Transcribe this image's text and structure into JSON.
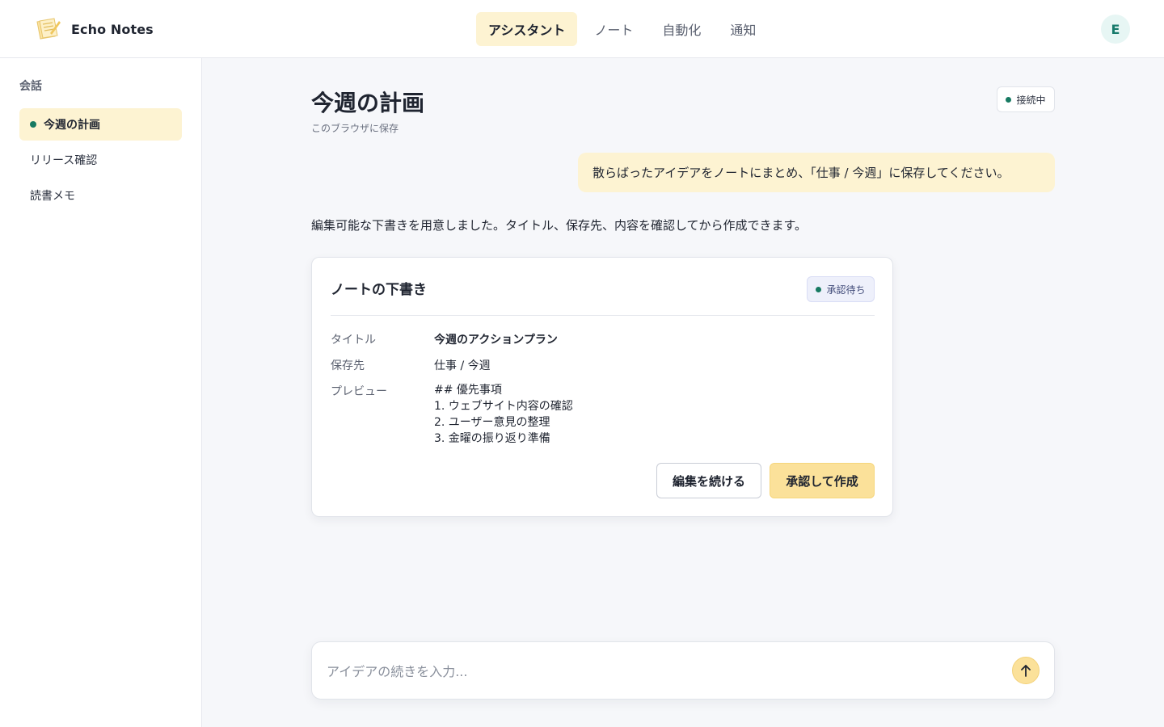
{
  "app": {
    "name": "Echo Notes"
  },
  "nav": {
    "tabs": [
      {
        "label": "アシスタント",
        "active": true
      },
      {
        "label": "ノート",
        "active": false
      },
      {
        "label": "自動化",
        "active": false
      },
      {
        "label": "通知",
        "active": false
      }
    ]
  },
  "user": {
    "avatar_initial": "E"
  },
  "sidebar": {
    "heading": "会話",
    "items": [
      {
        "label": "今週の計画",
        "active": true
      },
      {
        "label": "リリース確認",
        "active": false
      },
      {
        "label": "読書メモ",
        "active": false
      }
    ]
  },
  "conversation": {
    "title": "今週の計画",
    "subtitle": "このブラウザに保存",
    "status": "接続中",
    "user_message": "散らばったアイデアをノートにまとめ、「仕事 / 今週」に保存してください。",
    "assistant_message": "編集可能な下書きを用意しました。タイトル、保存先、内容を確認してから作成できます。"
  },
  "draft": {
    "heading": "ノートの下書き",
    "badge": "承認待ち",
    "fields": {
      "title_label": "タイトル",
      "title_value": "今週のアクションプラン",
      "location_label": "保存先",
      "location_value": "仕事 / 今週",
      "preview_label": "プレビュー",
      "preview_lines": [
        "## 優先事項",
        "1. ウェブサイト内容の確認",
        "2. ユーザー意見の整理",
        "3. 金曜の振り返り準備"
      ]
    },
    "buttons": {
      "continue_editing": "編集を続ける",
      "approve_create": "承認して作成"
    }
  },
  "composer": {
    "placeholder": "アイデアの続きを入力...",
    "value": "",
    "send_icon": "arrow-up-icon"
  },
  "colors": {
    "accent": "#fbe19a",
    "accent_soft": "#fdf3d2",
    "status_green": "#177a62",
    "background": "#f6f7fa"
  }
}
